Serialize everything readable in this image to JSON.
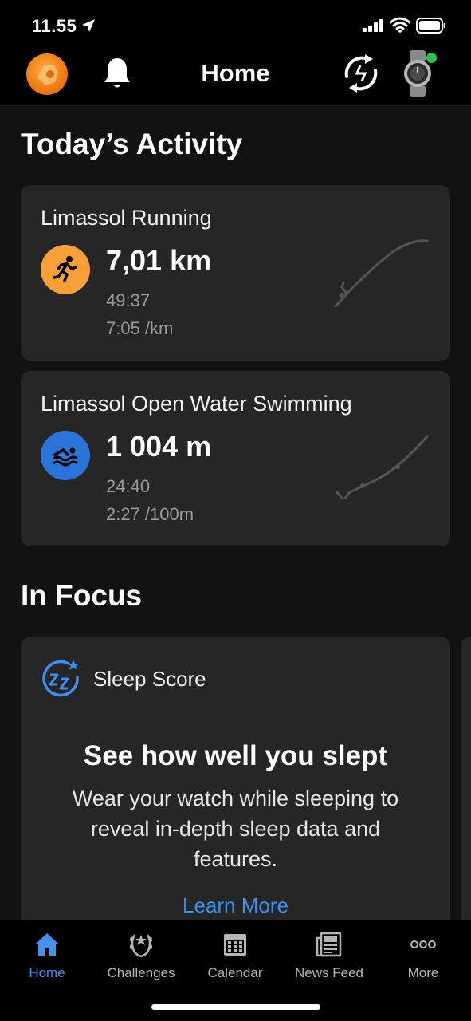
{
  "status_bar": {
    "time": "11.55",
    "icons": [
      "location-arrow-icon",
      "signal-icon",
      "wifi-icon",
      "battery-icon"
    ]
  },
  "header": {
    "title": "Home",
    "icons": [
      "avatar",
      "bell-icon",
      "sync-icon",
      "watch-icon"
    ],
    "device_status_color": "#2fc24a"
  },
  "todays_activity": {
    "heading": "Today’s Activity",
    "activities": [
      {
        "title": "Limassol Running",
        "icon": "running-icon",
        "value": "7,01 km",
        "duration": "49:37",
        "pace": "7:05 /km",
        "color": "#f7a03a"
      },
      {
        "title": "Limassol Open Water Swimming",
        "icon": "swimming-icon",
        "value": "1 004 m",
        "duration": "24:40",
        "pace": "2:27 /100m",
        "color": "#2b73d6"
      }
    ]
  },
  "in_focus": {
    "heading": "In Focus",
    "card": {
      "label": "Sleep Score",
      "icon": "sleep-score-icon",
      "headline": "See how well you slept",
      "body": "Wear your watch while sleeping to reveal in-depth sleep data and features.",
      "link": "Learn More"
    }
  },
  "tab_bar": {
    "tabs": [
      {
        "label": "Home",
        "icon": "home-icon",
        "active": true
      },
      {
        "label": "Challenges",
        "icon": "laurel-icon",
        "active": false
      },
      {
        "label": "Calendar",
        "icon": "calendar-icon",
        "active": false
      },
      {
        "label": "News Feed",
        "icon": "news-feed-icon",
        "active": false
      },
      {
        "label": "More",
        "icon": "more-icon",
        "active": false
      }
    ]
  },
  "colors": {
    "accent": "#4a90e8",
    "link": "#3d8ff0",
    "card": "#262626",
    "background": "#121212"
  }
}
